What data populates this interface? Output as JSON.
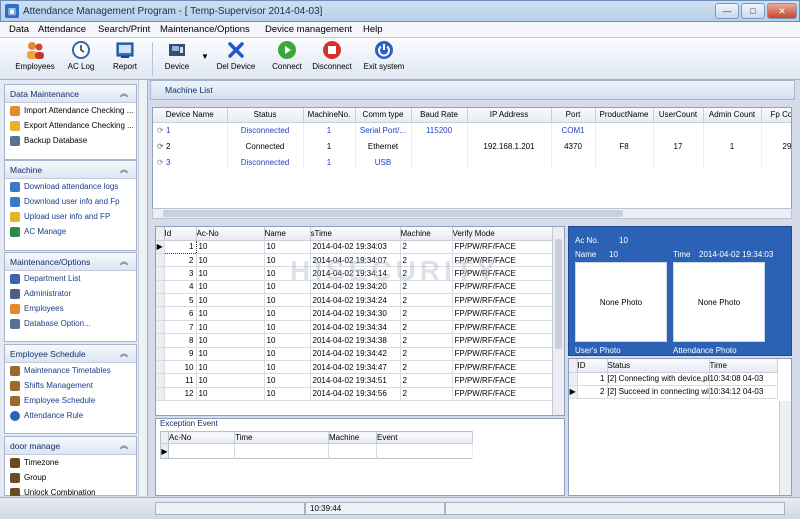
{
  "window": {
    "title": "Attendance Management Program - [ Temp-Supervisor 2014-04-03]",
    "min": "—",
    "max": "□",
    "close": "✕"
  },
  "menu": [
    "Data",
    "Attendance",
    "Search/Print",
    "Maintenance/Options",
    "Device management",
    "Help"
  ],
  "toolbar": {
    "employees": "Employees",
    "aclog": "AC Log",
    "report": "Report",
    "device": "Device",
    "deldevice": "Del Device",
    "connect": "Connect",
    "disconnect": "Disconnect",
    "exit": "Exit system"
  },
  "sidebar": {
    "groups": [
      {
        "title": "Data Maintenance",
        "items": [
          "Import Attendance Checking ...",
          "Export Attendance Checking ...",
          "Backup Database"
        ]
      },
      {
        "title": "Machine",
        "items": [
          "Download attendance logs",
          "Download user info and Fp",
          "Upload user info and FP",
          "AC Manage"
        ]
      },
      {
        "title": "Maintenance/Options",
        "items": [
          "Department List",
          "Administrator",
          "Employees",
          "Database Option..."
        ]
      },
      {
        "title": "Employee Schedule",
        "items": [
          "Maintenance Timetables",
          "Shifts Management",
          "Employee Schedule",
          "Attendance Rule"
        ]
      },
      {
        "title": "door manage",
        "items": [
          "Timezone",
          "Group",
          "Unlock Combination"
        ]
      }
    ]
  },
  "machine_list": {
    "header": "Machine List",
    "columns": [
      "Device Name",
      "Status",
      "MachineNo.",
      "Comm type",
      "Baud Rate",
      "IP Address",
      "Port",
      "ProductName",
      "UserCount",
      "Admin Count",
      "Fp Count"
    ],
    "rows": [
      [
        "1",
        "Disconnected",
        "1",
        "Serial Port/...",
        "115200",
        "",
        "COM1",
        "",
        "",
        "",
        ""
      ],
      [
        "2",
        "Connected",
        "1",
        "Ethernet",
        "",
        "192.168.1.201",
        "4370",
        "F8",
        "17",
        "1",
        "29"
      ],
      [
        "3",
        "Disconnected",
        "1",
        "USB",
        "",
        "",
        "",
        "",
        "",
        "",
        ""
      ]
    ]
  },
  "attendance": {
    "columns": [
      "Id",
      "Ac-No",
      "Name",
      "sTime",
      "Machine",
      "Verify Mode"
    ],
    "rows": [
      [
        "1",
        "10",
        "10",
        "2014-04-02 19:34:03",
        "2",
        "FP/PW/RF/FACE"
      ],
      [
        "2",
        "10",
        "10",
        "2014-04-02 19:34:07",
        "2",
        "FP/PW/RF/FACE"
      ],
      [
        "3",
        "10",
        "10",
        "2014-04-02 19:34:14",
        "2",
        "FP/PW/RF/FACE"
      ],
      [
        "4",
        "10",
        "10",
        "2014-04-02 19:34:20",
        "2",
        "FP/PW/RF/FACE"
      ],
      [
        "5",
        "10",
        "10",
        "2014-04-02 19:34:24",
        "2",
        "FP/PW/RF/FACE"
      ],
      [
        "6",
        "10",
        "10",
        "2014-04-02 19:34:30",
        "2",
        "FP/PW/RF/FACE"
      ],
      [
        "7",
        "10",
        "10",
        "2014-04-02 19:34:34",
        "2",
        "FP/PW/RF/FACE"
      ],
      [
        "8",
        "10",
        "10",
        "2014-04-02 19:34:38",
        "2",
        "FP/PW/RF/FACE"
      ],
      [
        "9",
        "10",
        "10",
        "2014-04-02 19:34:42",
        "2",
        "FP/PW/RF/FACE"
      ],
      [
        "10",
        "10",
        "10",
        "2014-04-02 19:34:47",
        "2",
        "FP/PW/RF/FACE"
      ],
      [
        "11",
        "10",
        "10",
        "2014-04-02 19:34:51",
        "2",
        "FP/PW/RF/FACE"
      ],
      [
        "12",
        "10",
        "10",
        "2014-04-02 19:34:56",
        "2",
        "FP/PW/RF/FACE"
      ]
    ]
  },
  "watermark": "HISECURITY",
  "exception": {
    "title": "Exception Event",
    "columns": [
      "Ac-No",
      "Time",
      "Machine",
      "Event"
    ]
  },
  "photo_panel": {
    "acno_label": "Ac No.",
    "acno": "10",
    "name_label": "Name",
    "name": "10",
    "time_label": "Time",
    "time": "2014-04-02 19:34:03",
    "none_photo": "None Photo",
    "user_photo": "User's Photo",
    "att_photo": "Attendance Photo"
  },
  "log": {
    "columns": [
      "ID",
      "Status",
      "Time"
    ],
    "rows": [
      [
        "1",
        "[2] Connecting with device,pl",
        "10:34:08 04-03"
      ],
      [
        "2",
        "[2] Succeed in connecting wi",
        "10:34:12 04-03"
      ]
    ]
  },
  "status": {
    "time": "10:39:44"
  }
}
